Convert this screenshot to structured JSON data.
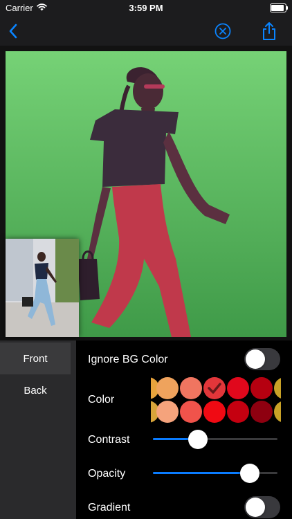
{
  "status": {
    "carrier": "Carrier",
    "time": "3:59 PM",
    "battery_level": 0.9,
    "icons": [
      "wifi-icon",
      "battery-icon"
    ]
  },
  "nav": {
    "icons": [
      "chevron-left-icon",
      "close-circle-icon",
      "share-icon"
    ],
    "accent_color": "#0a84ff"
  },
  "canvas": {
    "background_color": "#5cb85c",
    "subject_tint": "#c0394b"
  },
  "sidebar": {
    "tabs": [
      {
        "label": "Front",
        "selected": true
      },
      {
        "label": "Back",
        "selected": false
      }
    ]
  },
  "panel": {
    "ignore_bg": {
      "label": "Ignore BG Color",
      "on": false
    },
    "color": {
      "label": "Color",
      "swatches": [
        [
          "#e8a33c",
          "#efa35d",
          "#f07560",
          "#e2363a",
          "#e0081c",
          "#b50010",
          "#c9a227"
        ],
        [
          "#d8a43a",
          "#f5a37c",
          "#f0534b",
          "#f00a13",
          "#c50010",
          "#8e0010",
          "#c9a227"
        ]
      ],
      "selected": {
        "row": 0,
        "index": 3
      },
      "selected_icon": "checkmark-icon"
    },
    "contrast": {
      "label": "Contrast",
      "value": 0.36
    },
    "opacity": {
      "label": "Opacity",
      "value": 0.78
    },
    "gradient": {
      "label": "Gradient",
      "on": false
    }
  }
}
